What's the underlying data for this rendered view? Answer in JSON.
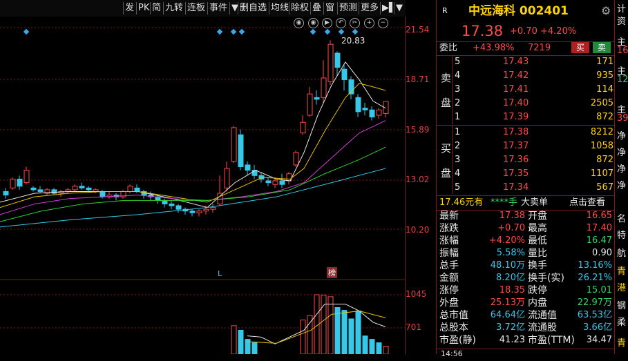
{
  "toolbar": {
    "items": [
      "发",
      "PK",
      "简",
      "九转",
      "连板",
      "事件",
      "▼",
      "删自选",
      "均线",
      "除权",
      "叠",
      "窗",
      "预测",
      "更多",
      "▶▌",
      "▼"
    ]
  },
  "chart": {
    "peak_label": "20.83",
    "price_ticks": [
      "21.54",
      "18.71",
      "15.89",
      "13.02",
      "10.20"
    ],
    "volume_ticks": [
      "1045",
      "701"
    ],
    "marker_L": "L",
    "marker_bang": "榜",
    "tool_icons": [
      "eye-icon",
      "eye-icon",
      "play-icon",
      "undo-icon",
      "scissors-icon",
      "plus-circle-icon",
      "minus-circle-icon"
    ]
  },
  "panel": {
    "r_badge": "R",
    "stock_title": "中远海科 002401",
    "price": "17.38",
    "change": "+0.70",
    "change_pct": "+4.20%",
    "weibi_label": "委比",
    "weibi_value": "+43.98%",
    "weicha_value": "7219",
    "buy_btn": "买",
    "sell_btn": "卖",
    "sell_label": "卖",
    "sell_label2": "盘",
    "buy_label": "买",
    "buy_label2": "盘",
    "asks": [
      {
        "level": "5",
        "price": "17.43",
        "vol": "171"
      },
      {
        "level": "4",
        "price": "17.42",
        "vol": "935"
      },
      {
        "level": "3",
        "price": "17.41",
        "vol": "114"
      },
      {
        "level": "2",
        "price": "17.40",
        "vol": "2505"
      },
      {
        "level": "1",
        "price": "17.39",
        "vol": "872"
      }
    ],
    "bids": [
      {
        "level": "1",
        "price": "17.38",
        "vol": "8212"
      },
      {
        "level": "2",
        "price": "17.37",
        "vol": "1058"
      },
      {
        "level": "3",
        "price": "17.36",
        "vol": "872"
      },
      {
        "level": "4",
        "price": "17.35",
        "vol": "1107"
      },
      {
        "level": "5",
        "price": "17.34",
        "vol": "567"
      }
    ],
    "bigorder": {
      "price": "17.46元有",
      "stars": "****手",
      "label": "大卖单",
      "link": "点击查看"
    },
    "stats": [
      {
        "l": "最新",
        "lv": "17.38",
        "r": "开盘",
        "rv": "16.65"
      },
      {
        "l": "涨跌",
        "lv": "+0.70",
        "r": "最高",
        "rv": "17.40"
      },
      {
        "l": "涨幅",
        "lv": "+4.20%",
        "r": "最低",
        "rv": "16.47"
      },
      {
        "l": "振幅",
        "lv": "5.58%",
        "r": "量比",
        "rv": "0.90"
      },
      {
        "l": "总手",
        "lv": "48.10万",
        "r": "换手",
        "rv": "13.16%"
      },
      {
        "l": "金额",
        "lv": "8.20亿",
        "r": "换手(实)",
        "rv": "26.21%"
      },
      {
        "l": "涨停",
        "lv": "18.35",
        "r": "跌停",
        "rv": "15.01"
      },
      {
        "l": "外盘",
        "lv": "25.13万",
        "r": "内盘",
        "rv": "22.97万"
      },
      {
        "l": "总市值",
        "lv": "64.64亿",
        "r": "流通值",
        "rv": "63.53亿"
      },
      {
        "l": "总股本",
        "lv": "3.72亿",
        "r": "流通股",
        "rv": "3.66亿"
      },
      {
        "l": "市盈(静)",
        "lv": "41.23",
        "r": "市盈(TTM)",
        "rv": "34.47"
      }
    ],
    "tail": "14:56"
  },
  "strip": {
    "items": [
      "计",
      "资",
      "主",
      "16",
      "主",
      "12",
      "主",
      "39",
      "净",
      "净",
      "净",
      "净",
      "名",
      "特",
      "航",
      "青",
      "港",
      "钢",
      "柔",
      "青"
    ]
  },
  "colors": {
    "up": "#ff4a4a",
    "down": "#37c8e8",
    "grid": "#7a1b1b"
  }
}
